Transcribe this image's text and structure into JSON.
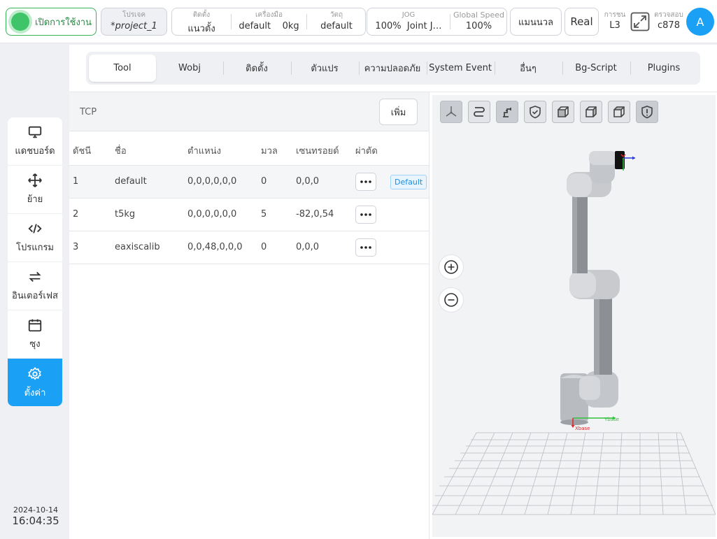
{
  "topbar": {
    "power_label": "เปิดการใช้งาน",
    "project": {
      "label": "โปรเจค",
      "value": "*project_1"
    },
    "install": {
      "label": "ติดตั้ง",
      "value": "แนวตั้ง"
    },
    "tool": {
      "label": "เครื่องมือ",
      "value": "default",
      "weight": "0kg"
    },
    "wobj": {
      "label": "วัตถุ",
      "value": "default"
    },
    "jog": {
      "label": "JOG",
      "speed": "100%",
      "mode": "Joint J…"
    },
    "global_speed": {
      "label": "Global Speed",
      "value": "100%"
    },
    "manual_label": "แมนนวล",
    "real_label": "Real",
    "level": {
      "label": "การชน",
      "value": "L3"
    },
    "check": {
      "label": "ตรวจสอบ",
      "value": "c878"
    },
    "avatar_letter": "A",
    "icons": {
      "expand": "expand-icon"
    }
  },
  "nav": {
    "items": [
      {
        "label": "แดชบอร์ด",
        "icon": "monitor-icon"
      },
      {
        "label": "ย้าย",
        "icon": "move-icon"
      },
      {
        "label": "โปรแกรม",
        "icon": "code-icon"
      },
      {
        "label": "อินเตอร์เฟส",
        "icon": "swap-icon"
      },
      {
        "label": "ซุง",
        "icon": "calendar-icon"
      },
      {
        "label": "ตั้งค่า",
        "icon": "gear-icon",
        "active": true
      }
    ],
    "date": "2024-10-14",
    "time": "16:04:35"
  },
  "tabs": [
    "Tool",
    "Wobj",
    "ติดตั้ง",
    "ตัวแปร",
    "ความปลอดภัย",
    "System Event",
    "อื่นๆ",
    "Bg-Script",
    "Plugins"
  ],
  "tcp": {
    "title": "TCP",
    "add_label": "เพิ่ม",
    "columns": [
      "ดัชนี",
      "ชื่อ",
      "ตำแหน่ง",
      "มวล",
      "เซนทรอยด์",
      "ผ่าตัด"
    ],
    "rows": [
      {
        "index": "1",
        "name": "default",
        "position": "0,0,0,0,0,0",
        "mass": "0",
        "centroid": "0,0,0",
        "badge": "Default"
      },
      {
        "index": "2",
        "name": "t5kg",
        "position": "0,0,0,0,0,0",
        "mass": "5",
        "centroid": "-82,0,54",
        "badge": ""
      },
      {
        "index": "3",
        "name": "eaxiscalib",
        "position": "0,0,48,0,0,0",
        "mass": "0",
        "centroid": "0,0,0",
        "badge": ""
      }
    ]
  },
  "viewer": {
    "axis_labels": {
      "x": "Xbase",
      "y": "Ybase"
    }
  },
  "colors": {
    "accent": "#1aa1f5",
    "power_green": "#3fc46a"
  }
}
